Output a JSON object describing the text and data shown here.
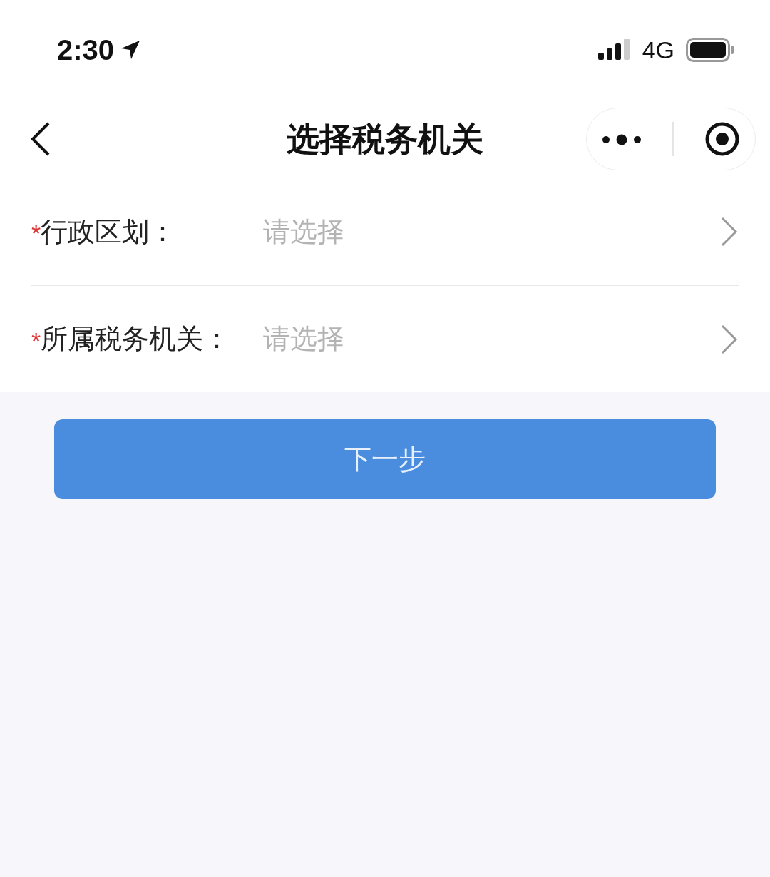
{
  "status_bar": {
    "time": "2:30",
    "network": "4G"
  },
  "nav": {
    "title": "选择税务机关"
  },
  "fields": [
    {
      "required_mark": "*",
      "label": "行政区划：",
      "placeholder": "请选择"
    },
    {
      "required_mark": "*",
      "label": "所属税务机关：",
      "placeholder": "请选择"
    }
  ],
  "button": {
    "label": "下一步"
  }
}
